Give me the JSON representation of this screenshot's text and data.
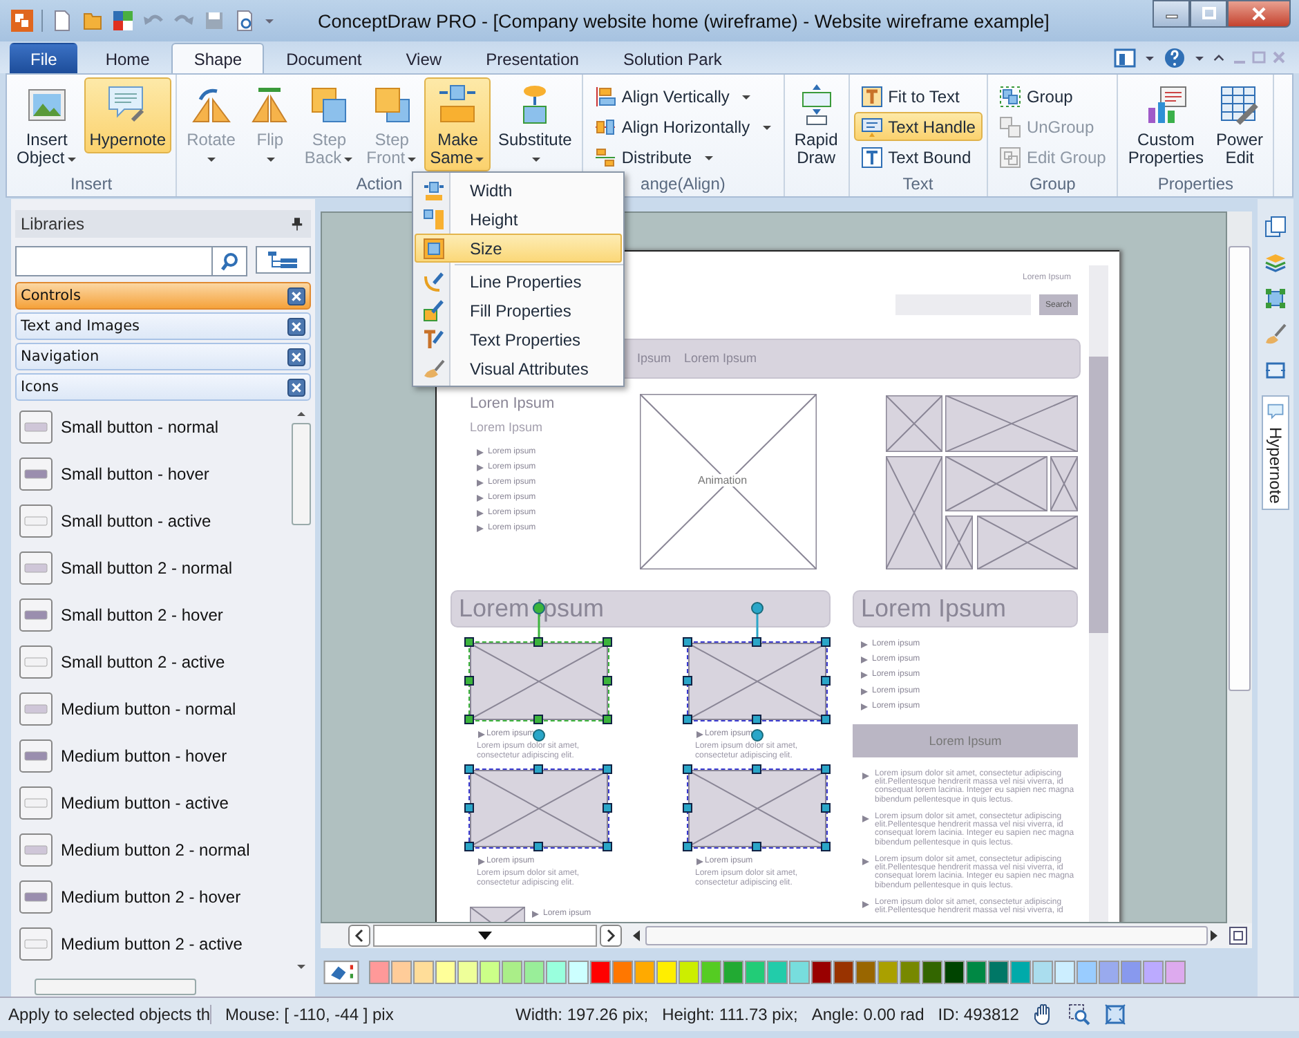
{
  "window": {
    "title": "ConceptDraw PRO - [Company website home (wireframe) - Website wireframe example]"
  },
  "menu_tabs": [
    {
      "label": "File",
      "kind": "file",
      "selected": false
    },
    {
      "label": "Home",
      "kind": "tab",
      "selected": false
    },
    {
      "label": "Shape",
      "kind": "tab",
      "selected": true
    },
    {
      "label": "Document",
      "kind": "tab",
      "selected": false
    },
    {
      "label": "View",
      "kind": "tab",
      "selected": false
    },
    {
      "label": "Presentation",
      "kind": "tab",
      "selected": false
    },
    {
      "label": "Solution Park",
      "kind": "tab",
      "selected": false
    }
  ],
  "ribbon": {
    "groups": [
      {
        "label": "Insert",
        "kind": "large",
        "items": [
          {
            "label_lines": [
              "Insert",
              "Object"
            ],
            "dropdown": true,
            "highlighted": false,
            "disabled": false
          },
          {
            "label_lines": [
              "Hypernote"
            ],
            "dropdown": false,
            "highlighted": true,
            "disabled": false
          }
        ]
      },
      {
        "label": "Action",
        "kind": "large",
        "items": [
          {
            "label_lines": [
              "Rotate"
            ],
            "dropdown": true,
            "highlighted": false,
            "disabled": true
          },
          {
            "label_lines": [
              "Flip"
            ],
            "dropdown": true,
            "highlighted": false,
            "disabled": true
          },
          {
            "label_lines": [
              "Step",
              "Back"
            ],
            "dropdown": true,
            "highlighted": false,
            "disabled": true
          },
          {
            "label_lines": [
              "Step",
              "Front"
            ],
            "dropdown": true,
            "highlighted": false,
            "disabled": true
          },
          {
            "label_lines": [
              "Make",
              "Same"
            ],
            "dropdown": true,
            "highlighted": true,
            "disabled": false
          },
          {
            "label_lines": [
              "Substitute"
            ],
            "dropdown": true,
            "highlighted": false,
            "disabled": false
          }
        ]
      },
      {
        "label": "ange(Align)",
        "kind": "small",
        "items": [
          {
            "label_lines": [
              "Align Vertically"
            ],
            "dropdown": true,
            "highlighted": false,
            "disabled": false
          },
          {
            "label_lines": [
              "Align Horizontally"
            ],
            "dropdown": true,
            "highlighted": false,
            "disabled": false
          },
          {
            "label_lines": [
              "Distribute"
            ],
            "dropdown": true,
            "highlighted": false,
            "disabled": false
          }
        ]
      },
      {
        "kind": "large",
        "items": [
          {
            "label_lines": [
              "Rapid",
              "Draw"
            ],
            "dropdown": false,
            "highlighted": false,
            "disabled": false
          }
        ]
      },
      {
        "label": "Text",
        "kind": "small",
        "items": [
          {
            "label_lines": [
              "Fit to Text"
            ],
            "dropdown": false,
            "highlighted": false,
            "disabled": false
          },
          {
            "label_lines": [
              "Text Handle"
            ],
            "dropdown": false,
            "highlighted": true,
            "disabled": false
          },
          {
            "label_lines": [
              "Text Bound"
            ],
            "dropdown": false,
            "highlighted": false,
            "disabled": false
          }
        ]
      },
      {
        "label": "Group",
        "kind": "small",
        "items": [
          {
            "label_lines": [
              "Group"
            ],
            "dropdown": false,
            "highlighted": false,
            "disabled": false
          },
          {
            "label_lines": [
              "UnGroup"
            ],
            "dropdown": false,
            "highlighted": false,
            "disabled": true
          },
          {
            "label_lines": [
              "Edit Group"
            ],
            "dropdown": false,
            "highlighted": false,
            "disabled": true
          }
        ]
      },
      {
        "label": "Properties",
        "kind": "large",
        "items": [
          {
            "label_lines": [
              "Custom",
              "Properties"
            ],
            "dropdown": false,
            "highlighted": false,
            "disabled": false
          },
          {
            "label_lines": [
              "Power",
              "Edit"
            ],
            "dropdown": false,
            "highlighted": false,
            "disabled": false
          }
        ]
      }
    ]
  },
  "make_same_menu": {
    "items": [
      {
        "label": "Width",
        "selected": false,
        "separator_after": false
      },
      {
        "label": "Height",
        "selected": false,
        "separator_after": false
      },
      {
        "label": "Size",
        "selected": true,
        "separator_after": true
      },
      {
        "label": "Line Properties",
        "selected": false,
        "separator_after": false
      },
      {
        "label": "Fill Properties",
        "selected": false,
        "separator_after": false
      },
      {
        "label": "Text Properties",
        "selected": false,
        "separator_after": false
      },
      {
        "label": "Visual Attributes",
        "selected": false,
        "separator_after": false
      }
    ]
  },
  "libraries": {
    "title": "Libraries",
    "categories": [
      {
        "label": "Controls",
        "selected": true
      },
      {
        "label": "Text and Images",
        "selected": false
      },
      {
        "label": "Navigation",
        "selected": false
      },
      {
        "label": "Icons",
        "selected": false
      }
    ],
    "items": [
      "Small button - normal",
      "Small button - hover",
      "Small button - active",
      "Small button 2 - normal",
      "Small button 2 - hover",
      "Small button 2 - active",
      "Medium button - normal",
      "Medium button - hover",
      "Medium button - active",
      "Medium button 2 - normal",
      "Medium button 2 - hover",
      "Medium button 2 - active"
    ]
  },
  "page": {
    "top_link": "Lorem Ipsum",
    "search_button": "Search",
    "nav_items": [
      "Ipsum",
      "Lorem Ipsum"
    ],
    "intro": {
      "title": "Loren Ipsum",
      "subtitle": "Lorem Ipsum",
      "bullets": [
        "Lorem ipsum",
        "Lorem ipsum",
        "Lorem ipsum",
        "Lorem ipsum",
        "Lorem ipsum",
        "Lorem ipsum"
      ]
    },
    "animation": {
      "label": "Animation"
    },
    "section_titles": [
      "Lorem Ipsum",
      "Lorem Ipsum"
    ],
    "cards": [
      {
        "caption": "Lorem ipsum",
        "text": "Lorem ipsum dolor sit amet, consectetur adipiscing elit.",
        "primary_selection": true
      },
      {
        "caption": "Lorem ipsum",
        "text": "Lorem ipsum dolor sit amet, consectetur adipiscing elit.",
        "primary_selection": false
      },
      {
        "caption": "Lorem ipsum",
        "text": "Lorem ipsum dolor sit amet, consectetur adipiscing elit.",
        "primary_selection": false
      },
      {
        "caption": "Lorem ipsum",
        "text": "Lorem ipsum dolor sit amet, consectetur adipiscing elit.",
        "primary_selection": false
      }
    ],
    "sidebar": {
      "bullets": [
        "Lorem ipsum",
        "Lorem ipsum",
        "Lorem ipsum",
        "Lorem ipsum",
        "Lorem ipsum"
      ],
      "button": "Lorem Ipsum",
      "paragraphs": [
        "Lorem ipsum dolor sit amet, consectetur adipiscing elit.Pellentesque hendrerit massa vel nisi viverra, id consequat lorem lacinia. Integer eu sapien nec magna bibendum pellentesque in quis lectus.",
        "Lorem ipsum dolor sit amet, consectetur adipiscing elit.Pellentesque hendrerit massa vel nisi viverra, id consequat lorem lacinia. Integer eu sapien nec magna bibendum pellentesque in quis lectus.",
        "Lorem ipsum dolor sit amet, consectetur adipiscing elit.Pellentesque hendrerit massa vel nisi viverra, id consequat lorem lacinia. Integer eu sapien nec magna bibendum pellentesque in quis lectus.",
        "Lorem ipsum dolor sit amet, consectetur adipiscing elit.Pellentesque hendrerit massa vel nisi viverra, id"
      ]
    },
    "footer_item": {
      "caption": "Lorem ipsum"
    }
  },
  "palette": [
    {
      "color": "#ff9999"
    },
    {
      "color": "#ffcc99"
    },
    {
      "color": "#ffdd99"
    },
    {
      "color": "#ffff99"
    },
    {
      "color": "#eeff99"
    },
    {
      "color": "#ccff88"
    },
    {
      "color": "#aaee88"
    },
    {
      "color": "#99ee99"
    },
    {
      "color": "#99ffdd"
    },
    {
      "color": "#ccffff"
    },
    {
      "color": "#ff0000"
    },
    {
      "color": "#ff7700"
    },
    {
      "color": "#ffaa00"
    },
    {
      "color": "#ffee00"
    },
    {
      "color": "#ccee00"
    },
    {
      "color": "#55cc22"
    },
    {
      "color": "#22aa33"
    },
    {
      "color": "#22cc77"
    },
    {
      "color": "#22ccaa"
    },
    {
      "color": "#77dddd"
    },
    {
      "color": "#990000"
    },
    {
      "color": "#993300"
    },
    {
      "color": "#996600"
    },
    {
      "color": "#aaa000"
    },
    {
      "color": "#778800"
    },
    {
      "color": "#336600"
    },
    {
      "color": "#004400"
    },
    {
      "color": "#008844"
    },
    {
      "color": "#007766"
    },
    {
      "color": "#00aaaa"
    },
    {
      "color": "#aaddee"
    },
    {
      "color": "#cceeff"
    },
    {
      "color": "#99ccff"
    },
    {
      "color": "#99aaee"
    },
    {
      "color": "#8899ee"
    },
    {
      "color": "#bbaaff"
    },
    {
      "color": "#ddaaee"
    }
  ],
  "right_panel": {
    "tab": "Hypernote"
  },
  "status_bar": {
    "hint": "Apply to selected objects th",
    "mouse": "Mouse: [ -110, -44 ] pix",
    "width": "Width: 197.26 pix;",
    "height": "Height: 111.73 pix;",
    "angle": "Angle: 0.00 rad",
    "id": "ID: 493812"
  }
}
